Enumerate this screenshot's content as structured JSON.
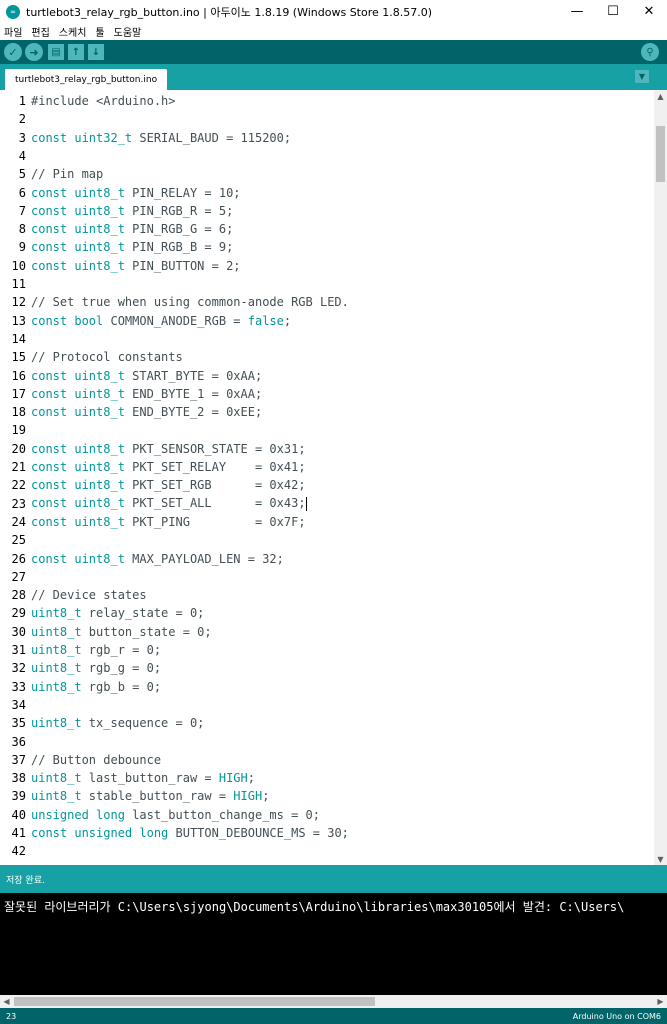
{
  "window": {
    "title": "turtlebot3_relay_rgb_button.ino | 아두이노 1.8.19 (Windows Store 1.8.57.0)",
    "minimize": "—",
    "maximize": "☐",
    "close": "✕"
  },
  "menu": [
    "파일",
    "편집",
    "스케치",
    "툴",
    "도움말"
  ],
  "toolbar": {
    "verify_icon": "check-icon",
    "upload_icon": "arrow-right-icon",
    "new_icon": "new-file-icon",
    "open_icon": "arrow-up-icon",
    "save_icon": "arrow-down-icon",
    "serial_icon": "magnifier-icon"
  },
  "tabs": [
    {
      "label": "turtlebot3_relay_rgb_button.ino"
    }
  ],
  "code": [
    {
      "n": "1",
      "parts": [
        {
          "t": "#include <Arduino.h>",
          "c": "code"
        }
      ]
    },
    {
      "n": "2",
      "parts": []
    },
    {
      "n": "3",
      "parts": [
        {
          "t": "const uint32_t",
          "c": "kw"
        },
        {
          "t": " SERIAL_BAUD = 115200;",
          "c": "code"
        }
      ]
    },
    {
      "n": "4",
      "parts": []
    },
    {
      "n": "5",
      "parts": [
        {
          "t": "// Pin map",
          "c": "cm"
        }
      ]
    },
    {
      "n": "6",
      "parts": [
        {
          "t": "const uint8_t",
          "c": "kw"
        },
        {
          "t": " PIN_RELAY = 10;",
          "c": "code"
        }
      ]
    },
    {
      "n": "7",
      "parts": [
        {
          "t": "const uint8_t",
          "c": "kw"
        },
        {
          "t": " PIN_RGB_R = 5;",
          "c": "code"
        }
      ]
    },
    {
      "n": "8",
      "parts": [
        {
          "t": "const uint8_t",
          "c": "kw"
        },
        {
          "t": " PIN_RGB_G = 6;",
          "c": "code"
        }
      ]
    },
    {
      "n": "9",
      "parts": [
        {
          "t": "const uint8_t",
          "c": "kw"
        },
        {
          "t": " PIN_RGB_B = 9;",
          "c": "code"
        }
      ]
    },
    {
      "n": "10",
      "parts": [
        {
          "t": "const uint8_t",
          "c": "kw"
        },
        {
          "t": " PIN_BUTTON = 2;",
          "c": "code"
        }
      ]
    },
    {
      "n": "11",
      "parts": []
    },
    {
      "n": "12",
      "parts": [
        {
          "t": "// Set true when using common-anode RGB LED.",
          "c": "cm"
        }
      ]
    },
    {
      "n": "13",
      "parts": [
        {
          "t": "const bool",
          "c": "kw"
        },
        {
          "t": " COMMON_ANODE_RGB = ",
          "c": "code"
        },
        {
          "t": "false",
          "c": "kw"
        },
        {
          "t": ";",
          "c": "code"
        }
      ]
    },
    {
      "n": "14",
      "parts": []
    },
    {
      "n": "15",
      "parts": [
        {
          "t": "// Protocol constants",
          "c": "cm"
        }
      ]
    },
    {
      "n": "16",
      "parts": [
        {
          "t": "const uint8_t",
          "c": "kw"
        },
        {
          "t": " START_BYTE = 0xAA;",
          "c": "code"
        }
      ]
    },
    {
      "n": "17",
      "parts": [
        {
          "t": "const uint8_t",
          "c": "kw"
        },
        {
          "t": " END_BYTE_1 = 0xAA;",
          "c": "code"
        }
      ]
    },
    {
      "n": "18",
      "parts": [
        {
          "t": "const uint8_t",
          "c": "kw"
        },
        {
          "t": " END_BYTE_2 = 0xEE;",
          "c": "code"
        }
      ]
    },
    {
      "n": "19",
      "parts": []
    },
    {
      "n": "20",
      "parts": [
        {
          "t": "const uint8_t",
          "c": "kw"
        },
        {
          "t": " PKT_SENSOR_STATE = 0x31;",
          "c": "code"
        }
      ]
    },
    {
      "n": "21",
      "parts": [
        {
          "t": "const uint8_t",
          "c": "kw"
        },
        {
          "t": " PKT_SET_RELAY    = 0x41;",
          "c": "code"
        }
      ]
    },
    {
      "n": "22",
      "parts": [
        {
          "t": "const uint8_t",
          "c": "kw"
        },
        {
          "t": " PKT_SET_RGB      = 0x42;",
          "c": "code"
        }
      ]
    },
    {
      "n": "23",
      "parts": [
        {
          "t": "const uint8_t",
          "c": "kw"
        },
        {
          "t": " PKT_SET_ALL      = 0x43;",
          "c": "code"
        }
      ],
      "cursor": true
    },
    {
      "n": "24",
      "parts": [
        {
          "t": "const uint8_t",
          "c": "kw"
        },
        {
          "t": " PKT_PING         = 0x7F;",
          "c": "code"
        }
      ]
    },
    {
      "n": "25",
      "parts": []
    },
    {
      "n": "26",
      "parts": [
        {
          "t": "const uint8_t",
          "c": "kw"
        },
        {
          "t": " MAX_PAYLOAD_LEN = 32;",
          "c": "code"
        }
      ]
    },
    {
      "n": "27",
      "parts": []
    },
    {
      "n": "28",
      "parts": [
        {
          "t": "// Device states",
          "c": "cm"
        }
      ]
    },
    {
      "n": "29",
      "parts": [
        {
          "t": "uint8_t",
          "c": "kw"
        },
        {
          "t": " relay_state = 0;",
          "c": "code"
        }
      ]
    },
    {
      "n": "30",
      "parts": [
        {
          "t": "uint8_t",
          "c": "kw"
        },
        {
          "t": " button_state = 0;",
          "c": "code"
        }
      ]
    },
    {
      "n": "31",
      "parts": [
        {
          "t": "uint8_t",
          "c": "kw"
        },
        {
          "t": " rgb_r = 0;",
          "c": "code"
        }
      ]
    },
    {
      "n": "32",
      "parts": [
        {
          "t": "uint8_t",
          "c": "kw"
        },
        {
          "t": " rgb_g = 0;",
          "c": "code"
        }
      ]
    },
    {
      "n": "33",
      "parts": [
        {
          "t": "uint8_t",
          "c": "kw"
        },
        {
          "t": " rgb_b = 0;",
          "c": "code"
        }
      ]
    },
    {
      "n": "34",
      "parts": []
    },
    {
      "n": "35",
      "parts": [
        {
          "t": "uint8_t",
          "c": "kw"
        },
        {
          "t": " tx_sequence = 0;",
          "c": "code"
        }
      ]
    },
    {
      "n": "36",
      "parts": []
    },
    {
      "n": "37",
      "parts": [
        {
          "t": "// Button debounce",
          "c": "cm"
        }
      ]
    },
    {
      "n": "38",
      "parts": [
        {
          "t": "uint8_t",
          "c": "kw"
        },
        {
          "t": " last_button_raw = ",
          "c": "code"
        },
        {
          "t": "HIGH",
          "c": "kw"
        },
        {
          "t": ";",
          "c": "code"
        }
      ]
    },
    {
      "n": "39",
      "parts": [
        {
          "t": "uint8_t",
          "c": "kw"
        },
        {
          "t": " stable_button_raw = ",
          "c": "code"
        },
        {
          "t": "HIGH",
          "c": "kw"
        },
        {
          "t": ";",
          "c": "code"
        }
      ]
    },
    {
      "n": "40",
      "parts": [
        {
          "t": "unsigned long",
          "c": "kw"
        },
        {
          "t": " last_button_change_ms = 0;",
          "c": "code"
        }
      ]
    },
    {
      "n": "41",
      "parts": [
        {
          "t": "const unsigned long",
          "c": "kw"
        },
        {
          "t": " BUTTON_DEBOUNCE_MS = 30;",
          "c": "code"
        }
      ]
    },
    {
      "n": "42",
      "parts": []
    }
  ],
  "status": {
    "message": "저장 완료."
  },
  "console": {
    "line": "잘못된 라이브러리가 C:\\Users\\sjyong\\Documents\\Arduino\\libraries\\max30105에서 발견: C:\\Users\\"
  },
  "footer": {
    "line": "23",
    "board": "Arduino Uno on COM6"
  }
}
